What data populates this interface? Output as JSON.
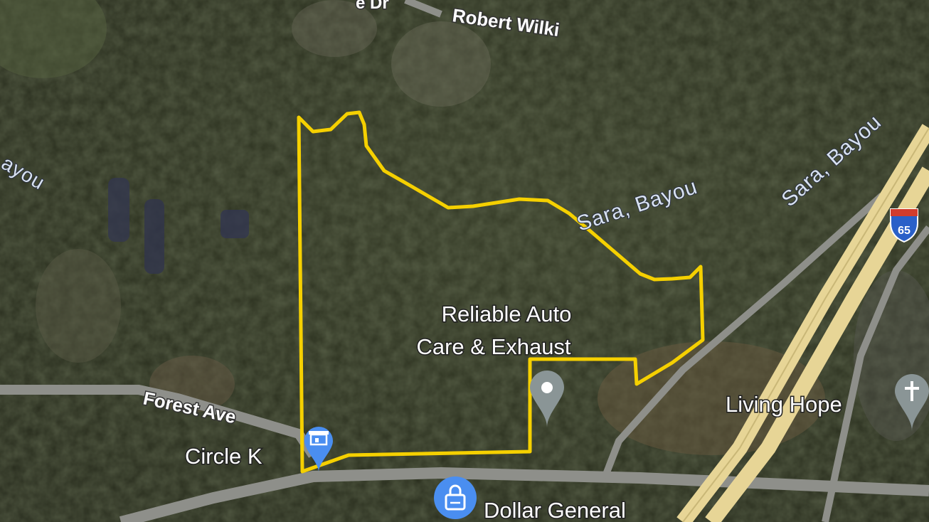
{
  "map": {
    "labels": {
      "road_top_partial": "Robert Wilki",
      "road_top_left_partial": "e Dr",
      "forest_ave": "Forest Ave",
      "water_left_partial": "ayou",
      "water_center": "Sara, Bayou",
      "water_right": "Sara, Bayou"
    },
    "places": {
      "auto_care_line1": "Reliable Auto",
      "auto_care_line2": "Care & Exhaust",
      "circle_k": "Circle K",
      "dollar_general": "Dollar General",
      "living_hope": "Living Hope"
    },
    "highway_shield": "65",
    "colors": {
      "parcel_outline": "#f5d000",
      "highway": "#e7d596",
      "road": "#8e8f8a",
      "pin_gray": "#8a9596",
      "pin_blue": "#4a8ef0",
      "shield_red": "#d23c2c",
      "shield_blue": "#2a60c8"
    },
    "icons": [
      "store-pin-icon",
      "shopping-bag-pin-icon",
      "place-pin-icon",
      "church-pin-icon",
      "interstate-shield-icon"
    ]
  }
}
